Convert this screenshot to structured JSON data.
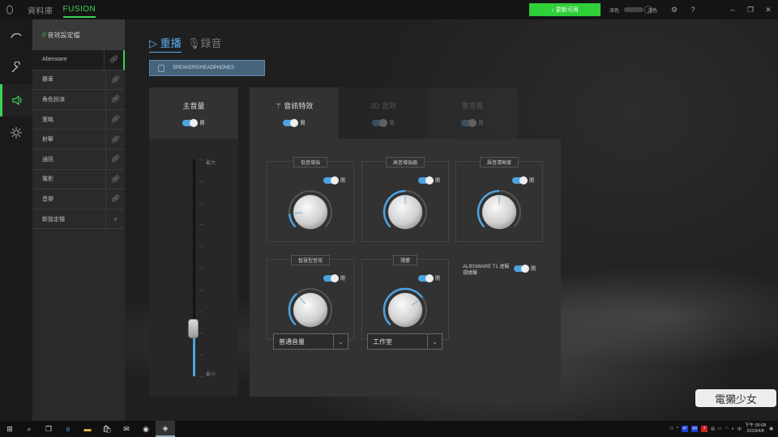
{
  "app": {
    "tabs": [
      {
        "label": "資料庫",
        "active": false
      },
      {
        "label": "FUSION",
        "active": true
      }
    ],
    "update_button": "↓ 更新可用",
    "mode_dark": "深色",
    "mode_light": "淺色"
  },
  "profiles": {
    "header_prefix": "//",
    "header": "音效設定檔",
    "items": [
      {
        "label": "Alienware",
        "selected": true,
        "action": "link"
      },
      {
        "label": "賽車",
        "selected": false,
        "action": "link"
      },
      {
        "label": "角色扮演",
        "selected": false,
        "action": "link"
      },
      {
        "label": "策略",
        "selected": false,
        "action": "link"
      },
      {
        "label": "射擊",
        "selected": false,
        "action": "link"
      },
      {
        "label": "通訊",
        "selected": false,
        "action": "link"
      },
      {
        "label": "電影",
        "selected": false,
        "action": "link"
      },
      {
        "label": "音樂",
        "selected": false,
        "action": "link"
      },
      {
        "label": "新設定檔",
        "selected": false,
        "action": "add"
      }
    ]
  },
  "audio": {
    "tab_playback": "▷ 重播",
    "tab_record": "錄音",
    "device": "SPEAKERS/HEADPHONES",
    "master": {
      "title": "主音量",
      "switch_label": "開",
      "max_label": "最大",
      "min_label": "最小",
      "level": 0.22
    },
    "fx_tabs": [
      {
        "title": "音訊特效",
        "switch_label": "開",
        "on": true
      },
      {
        "title": "3D 音效",
        "switch_label": "開",
        "on": false
      },
      {
        "title": "麥克風",
        "switch_label": "開",
        "on": false
      }
    ],
    "knobs": [
      {
        "label": "低音增強",
        "switch_label": "開",
        "value": 0.15
      },
      {
        "label": "高音增強器",
        "switch_label": "開",
        "value": 0.5
      },
      {
        "label": "語音清晰度",
        "switch_label": "開",
        "value": 0.5
      },
      {
        "label": "智慧型音效",
        "switch_label": "開",
        "value": 0.35
      },
      {
        "label": "殘響",
        "switch_label": "開",
        "value": 0.7
      }
    ],
    "dropdowns": [
      {
        "value": "普通音量"
      },
      {
        "value": "工作室"
      }
    ],
    "alienware_label": "ALIENWARE T1 虛擬環繞聲",
    "alienware_switch": "開"
  },
  "watermark": "電獺少女",
  "taskbar": {
    "time": "下午 09:08",
    "date": "2019/4/8",
    "badges": [
      {
        "text": "47",
        "color": "#1a3ccf"
      },
      {
        "text": "64",
        "color": "#1a3ccf"
      },
      {
        "text": "7",
        "color": "#cc2222"
      }
    ]
  }
}
